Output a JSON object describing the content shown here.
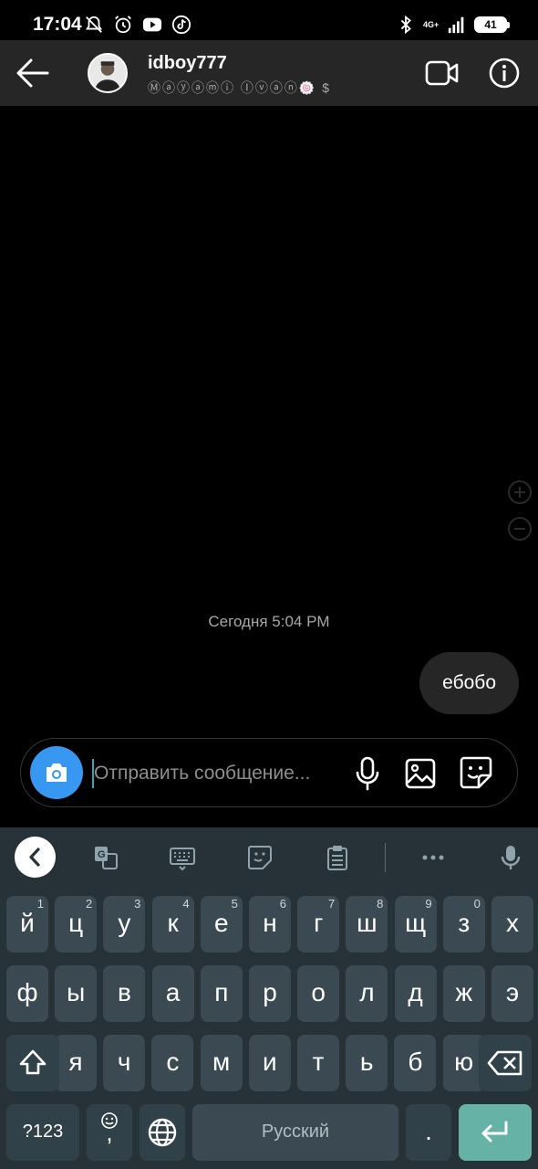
{
  "status_bar": {
    "time": "17:04",
    "network": "4G+",
    "battery": "41",
    "left_icons": [
      "silent-icon",
      "alarm-icon",
      "youtube-icon",
      "tiktok-icon"
    ],
    "right_icons": [
      "bluetooth-icon",
      "signal-icon",
      "battery-icon"
    ]
  },
  "header": {
    "username": "idboy777",
    "subtitle": "Ⓜⓐⓨⓐⓜⓘ Ⓘⓥⓐⓝ🍥 $"
  },
  "chat": {
    "timestamp": "Сегодня 5:04 PM",
    "messages": [
      {
        "text": "ебобо",
        "from": "me"
      }
    ]
  },
  "composer": {
    "placeholder": "Отправить сообщение...",
    "value": ""
  },
  "keyboard": {
    "rows": [
      [
        {
          "label": "й",
          "hint": "1"
        },
        {
          "label": "ц",
          "hint": "2"
        },
        {
          "label": "у",
          "hint": "3"
        },
        {
          "label": "к",
          "hint": "4"
        },
        {
          "label": "е",
          "hint": "5"
        },
        {
          "label": "н",
          "hint": "6"
        },
        {
          "label": "г",
          "hint": "7"
        },
        {
          "label": "ш",
          "hint": "8"
        },
        {
          "label": "щ",
          "hint": "9"
        },
        {
          "label": "з",
          "hint": "0"
        },
        {
          "label": "х",
          "hint": ""
        }
      ],
      [
        {
          "label": "ф"
        },
        {
          "label": "ы"
        },
        {
          "label": "в"
        },
        {
          "label": "а"
        },
        {
          "label": "п"
        },
        {
          "label": "р"
        },
        {
          "label": "о"
        },
        {
          "label": "л"
        },
        {
          "label": "д"
        },
        {
          "label": "ж"
        },
        {
          "label": "э"
        }
      ],
      [
        {
          "label": "я"
        },
        {
          "label": "ч"
        },
        {
          "label": "с"
        },
        {
          "label": "м"
        },
        {
          "label": "и"
        },
        {
          "label": "т"
        },
        {
          "label": "ь"
        },
        {
          "label": "б"
        },
        {
          "label": "ю"
        }
      ]
    ],
    "symbols_label": "?123",
    "comma_label": ",",
    "space_label": "Русский",
    "period_label": ".",
    "colors": {
      "background": "#263238",
      "key": "#3b4a52",
      "enter": "#66b2a6"
    }
  },
  "colors": {
    "accent": "#3897f0",
    "bubble": "#262626",
    "header": "#262626"
  }
}
